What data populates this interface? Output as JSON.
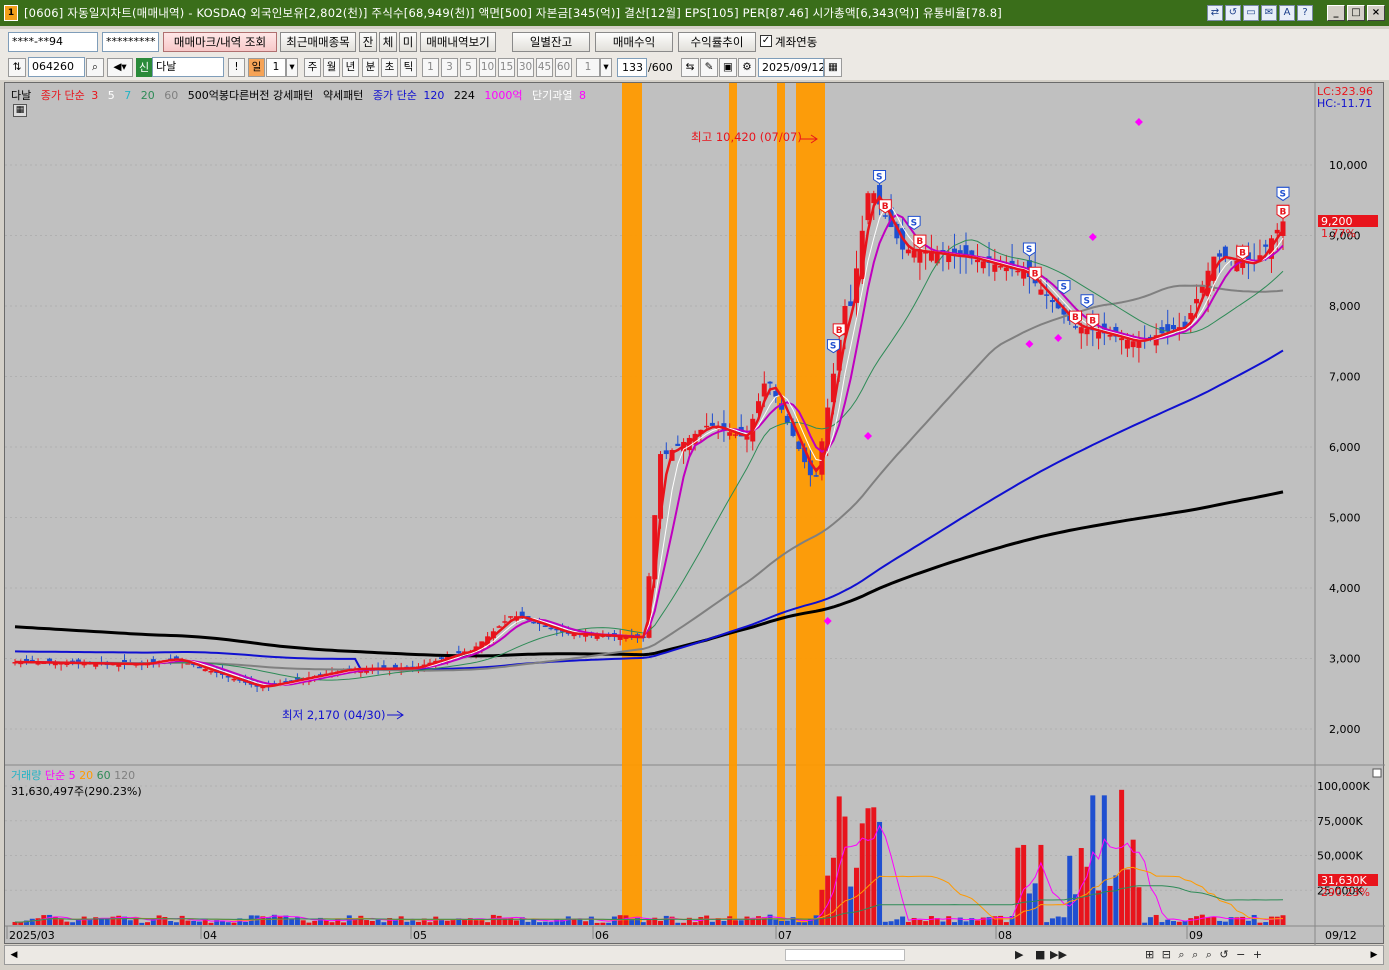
{
  "window": {
    "app_badge": "1",
    "title": "[0606] 자동일지차트(매매내역) - KOSDAQ 외국인보유[2,802(천)] 주식수[68,949(천)] 액면[500] 자본금[345(억)] 결산[12월] EPS[105] PER[87.46] 시가총액[6,343(억)] 유통비율[78.8]",
    "tool_icons": [
      "⇄",
      "↺",
      "▭",
      "✉",
      "A",
      "?"
    ],
    "controls": [
      "_",
      "□",
      "×"
    ]
  },
  "toolbar1": {
    "account_value": "****-**94",
    "password_value": "*********",
    "trade_mark_btn": "매매마크/내역 조회",
    "recent_stock_btn": "최근매매종목",
    "btn_jan": "잔",
    "btn_che": "체",
    "btn_mi": "미",
    "history_btn": "매매내역보기",
    "daily_balance_btn": "일별잔고",
    "trade_profit_btn": "매매수익",
    "return_trend_btn": "수익률추이",
    "account_link_label": "계좌연동"
  },
  "toolbar2": {
    "stock_code": "064260",
    "new_badge": "신",
    "stock_name": "다날",
    "excl": "!",
    "period_selected": "일",
    "period_count": "1",
    "period_buttons": [
      "주",
      "월",
      "년",
      "분",
      "초",
      "틱"
    ],
    "interval_buttons": [
      "1",
      "3",
      "5",
      "10",
      "15",
      "30",
      "45",
      "60"
    ],
    "interval_value": "1",
    "count_value": "133",
    "count_max": "/600",
    "date_value": "2025/09/12"
  },
  "legend": {
    "stock": "다날",
    "ma_title": "종가 단순",
    "ma_periods": [
      "3",
      "5",
      "7",
      "20",
      "60"
    ],
    "pattern_a": "500억봉다른버전 강세패턴",
    "pattern_b": "약세패턴",
    "ma2_title": "종가 단순",
    "ma2_periods": [
      "120",
      "224"
    ],
    "amount": "1000억",
    "short_over": "단기과열",
    "short_over_val": "8"
  },
  "price_axis": {
    "lc": "LC:323.96",
    "hc": "HC:-11.71",
    "ticks": [
      "10,000",
      "9,000",
      "8,000",
      "7,000",
      "6,000",
      "5,000",
      "4,000",
      "3,000",
      "2,000"
    ],
    "current": "9,200",
    "change": "1.77%"
  },
  "annotations": {
    "high_label": "최고 10,420 (07/07)",
    "low_label": "최저 2,170 (04/30)"
  },
  "volume": {
    "title": "거래량",
    "ma_title": "단순",
    "ma_periods": [
      "5",
      "20",
      "60",
      "120"
    ],
    "current_text": "31,630,497주(290.23%)",
    "ticks": [
      "100,000K",
      "75,000K",
      "50,000K",
      "25,000K"
    ],
    "current": "31,630K",
    "ratio": "290.23%"
  },
  "x_axis": {
    "labels": [
      "2025/03",
      "04",
      "05",
      "06",
      "07",
      "08",
      "09"
    ],
    "end_label": "09/12"
  },
  "scrollbar": {
    "controls": [
      "▶",
      "■",
      "▶▶"
    ]
  },
  "colors": {
    "up": "#e8141c",
    "down": "#1f4fd0",
    "highlight": "#ff9a00",
    "ma3": "#e8141c",
    "ma5": "#ffffff",
    "ma7": "#c000c0",
    "ma20": "#2e8b57",
    "ma60": "#808080",
    "ma120": "#1010d0",
    "ma224": "#000000"
  }
}
